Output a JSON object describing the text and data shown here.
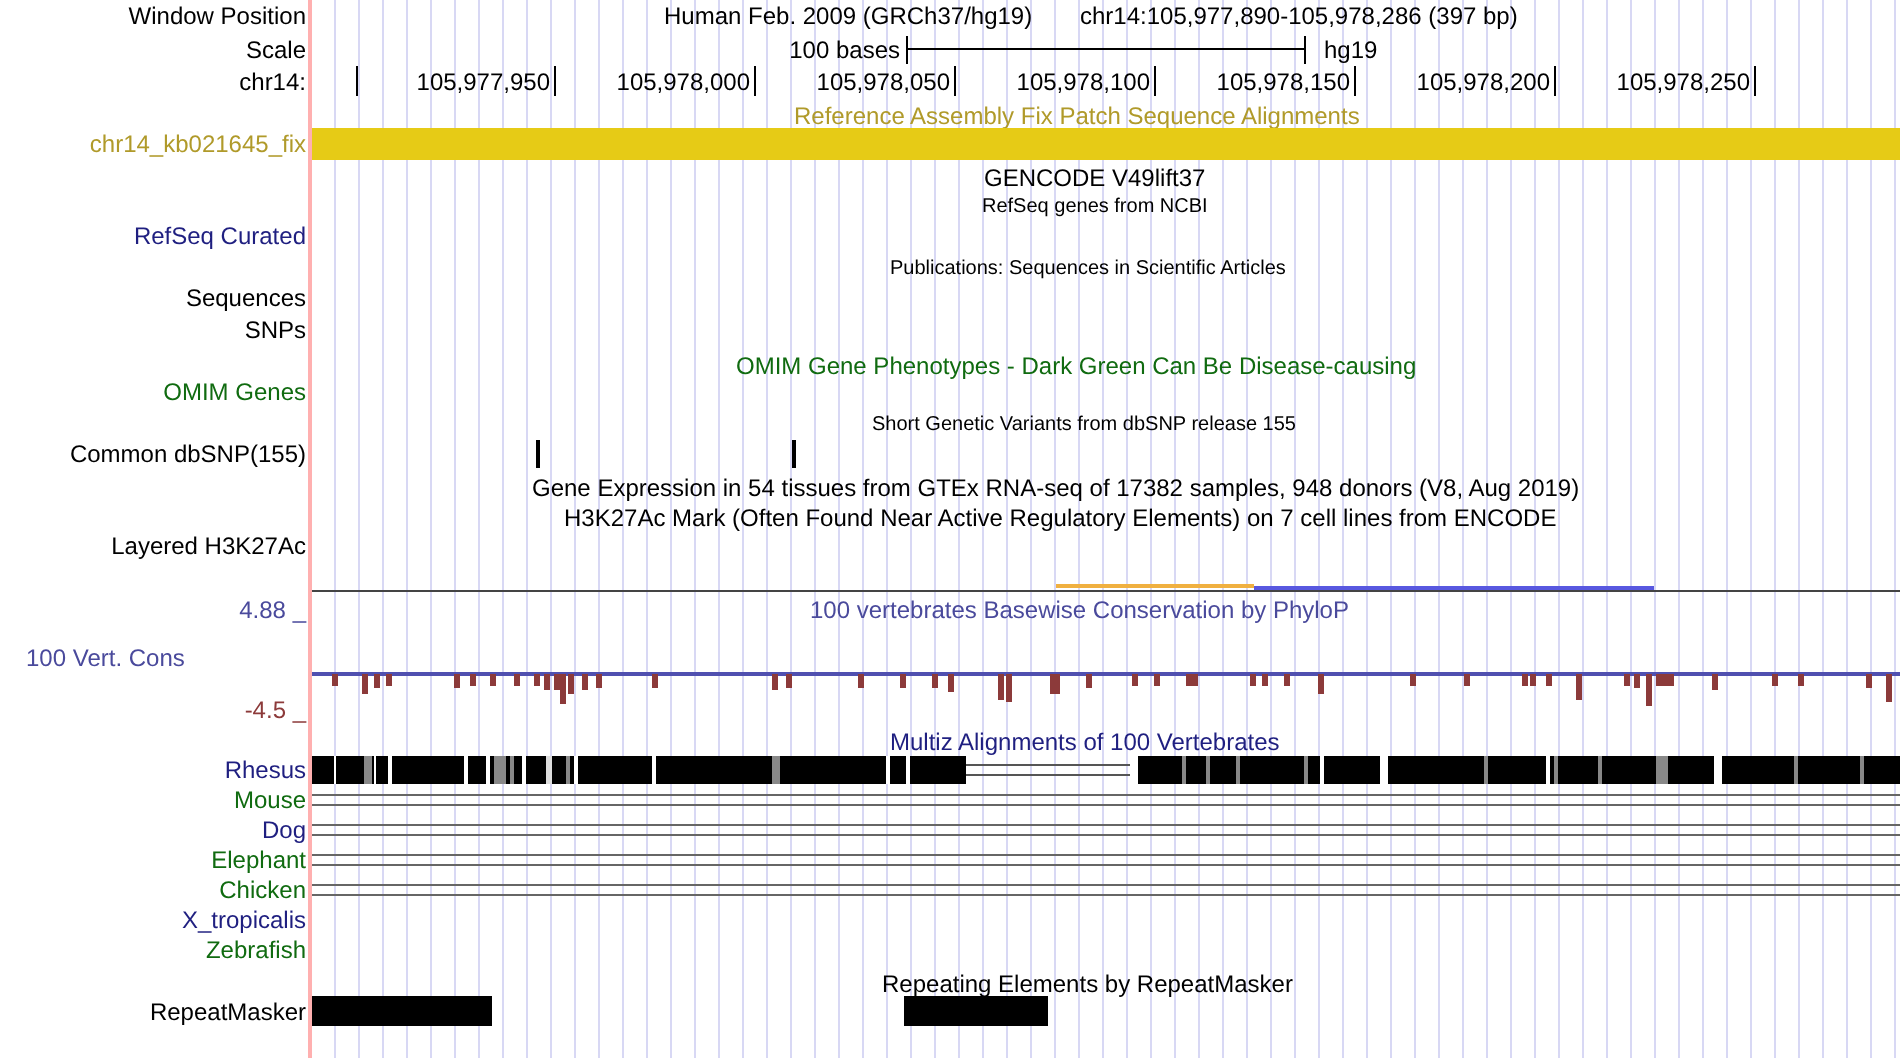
{
  "position": {
    "label": "Window Position",
    "assembly": "Human Feb. 2009 (GRCh37/hg19)",
    "range": "chr14:105,977,890-105,978,286 (397 bp)"
  },
  "scale": {
    "label": "Scale",
    "length": "100 bases",
    "db": "hg19"
  },
  "ruler": {
    "label": "chr14:",
    "ticks": [
      "105,977,950",
      "105,978,000",
      "105,978,050",
      "105,978,100",
      "105,978,150",
      "105,978,200",
      "105,978,250"
    ]
  },
  "fix_patch": {
    "title": "Reference Assembly Fix Patch Sequence Alignments",
    "label": "chr14_kb021645_fix"
  },
  "gencode": {
    "title": "GENCODE V49lift37",
    "subtitle": "RefSeq genes from NCBI",
    "label": "RefSeq Curated"
  },
  "publications": {
    "title": "Publications: Sequences in Scientific Articles",
    "labels": [
      "Sequences",
      "SNPs"
    ]
  },
  "omim": {
    "title": "OMIM Gene Phenotypes - Dark Green Can Be Disease-causing",
    "label": "OMIM Genes"
  },
  "dbsnp": {
    "title": "Short Genetic Variants from dbSNP release 155",
    "label": "Common dbSNP(155)"
  },
  "gtex": {
    "title": "Gene Expression in 54 tissues from GTEx RNA-seq of 17382 samples, 948 donors (V8, Aug 2019)"
  },
  "h3k27ac": {
    "title": "H3K27Ac Mark (Often Found Near Active Regulatory Elements) on 7 cell lines from ENCODE",
    "label": "Layered H3K27Ac"
  },
  "conservation": {
    "title": "100 vertebrates Basewise Conservation by PhyloP",
    "label": "100 Vert. Cons",
    "max": "4.88 _",
    "min": "-4.5 _"
  },
  "multiz": {
    "title": "Multiz Alignments of 100 Vertebrates",
    "species": [
      {
        "name": "Rhesus",
        "color": "#1f1f80",
        "kind": "blocks"
      },
      {
        "name": "Mouse",
        "color": "#106b10",
        "kind": "lines"
      },
      {
        "name": "Dog",
        "color": "#1f1f80",
        "kind": "lines"
      },
      {
        "name": "Elephant",
        "color": "#106b10",
        "kind": "lines"
      },
      {
        "name": "Chicken",
        "color": "#106b10",
        "kind": "lines"
      },
      {
        "name": "X_tropicalis",
        "color": "#1f1f80",
        "kind": "empty"
      },
      {
        "name": "Zebrafish",
        "color": "#106b10",
        "kind": "empty"
      }
    ]
  },
  "repeatmasker": {
    "title": "Repeating Elements by RepeatMasker",
    "label": "RepeatMasker"
  }
}
